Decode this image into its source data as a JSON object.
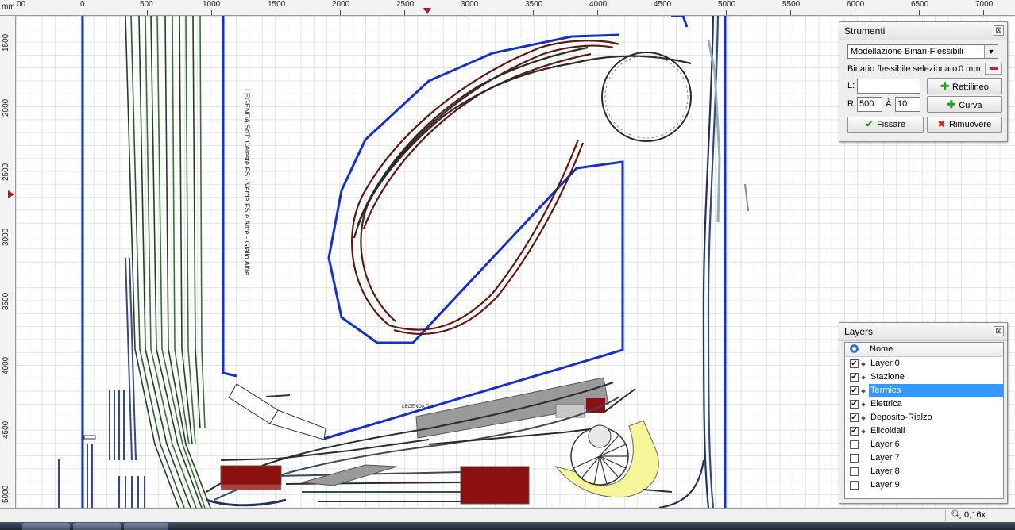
{
  "ruler": {
    "unit": "mm",
    "x_ticks": [
      "00",
      "0",
      "500",
      "1000",
      "1500",
      "2000",
      "2500",
      "3000",
      "3500",
      "4000",
      "4500",
      "5000",
      "5500",
      "6000",
      "6500",
      "7000"
    ],
    "y_ticks": [
      "1500",
      "2000",
      "2500",
      "3000",
      "3500",
      "4000",
      "4500",
      "5000"
    ]
  },
  "canvas": {
    "legend_text": "LEGENDA SdT: Celeste FS - Verde FS e Altre - Giallo Altre",
    "small_legend": "LEGENDA DL:"
  },
  "tools": {
    "title": "Strumenti",
    "mode_select": "Modellazione Binari-Flessibili",
    "selected_label": "Binario flessibile selezionato",
    "selected_value": "0 mm",
    "length_label": "L:",
    "length_value": "",
    "radius_label": "R:",
    "radius_value": "500",
    "angle_label": "À:",
    "angle_value": "10",
    "straight_button": "Rettilineo",
    "curve_button": "Curva",
    "fix_button": "Fissare",
    "remove_button": "Rimuovere",
    "close_glyph": "⊠"
  },
  "layers": {
    "title": "Layers",
    "header": "Nome",
    "close_glyph": "⊠",
    "items": [
      {
        "name": "Layer 0",
        "checked": true
      },
      {
        "name": "Stazione",
        "checked": true
      },
      {
        "name": "Termica",
        "checked": true,
        "selected": true
      },
      {
        "name": "Elettrica",
        "checked": true
      },
      {
        "name": "Deposito-Rialzo",
        "checked": true
      },
      {
        "name": "Elicoidali",
        "checked": true
      },
      {
        "name": "Layer 6",
        "checked": false
      },
      {
        "name": "Layer 7",
        "checked": false
      },
      {
        "name": "Layer 8",
        "checked": false
      },
      {
        "name": "Layer 9",
        "checked": false
      }
    ]
  },
  "status": {
    "zoom": "0,16x"
  },
  "colors": {
    "boundary": "#1530c8",
    "track_main": "#2b2b2b",
    "track_brown": "#6a1a12",
    "building_red": "#8c1010",
    "building_gray": "#9a9a9a",
    "turntable_yellow": "#f7f59a",
    "selection": "#3399ff"
  }
}
